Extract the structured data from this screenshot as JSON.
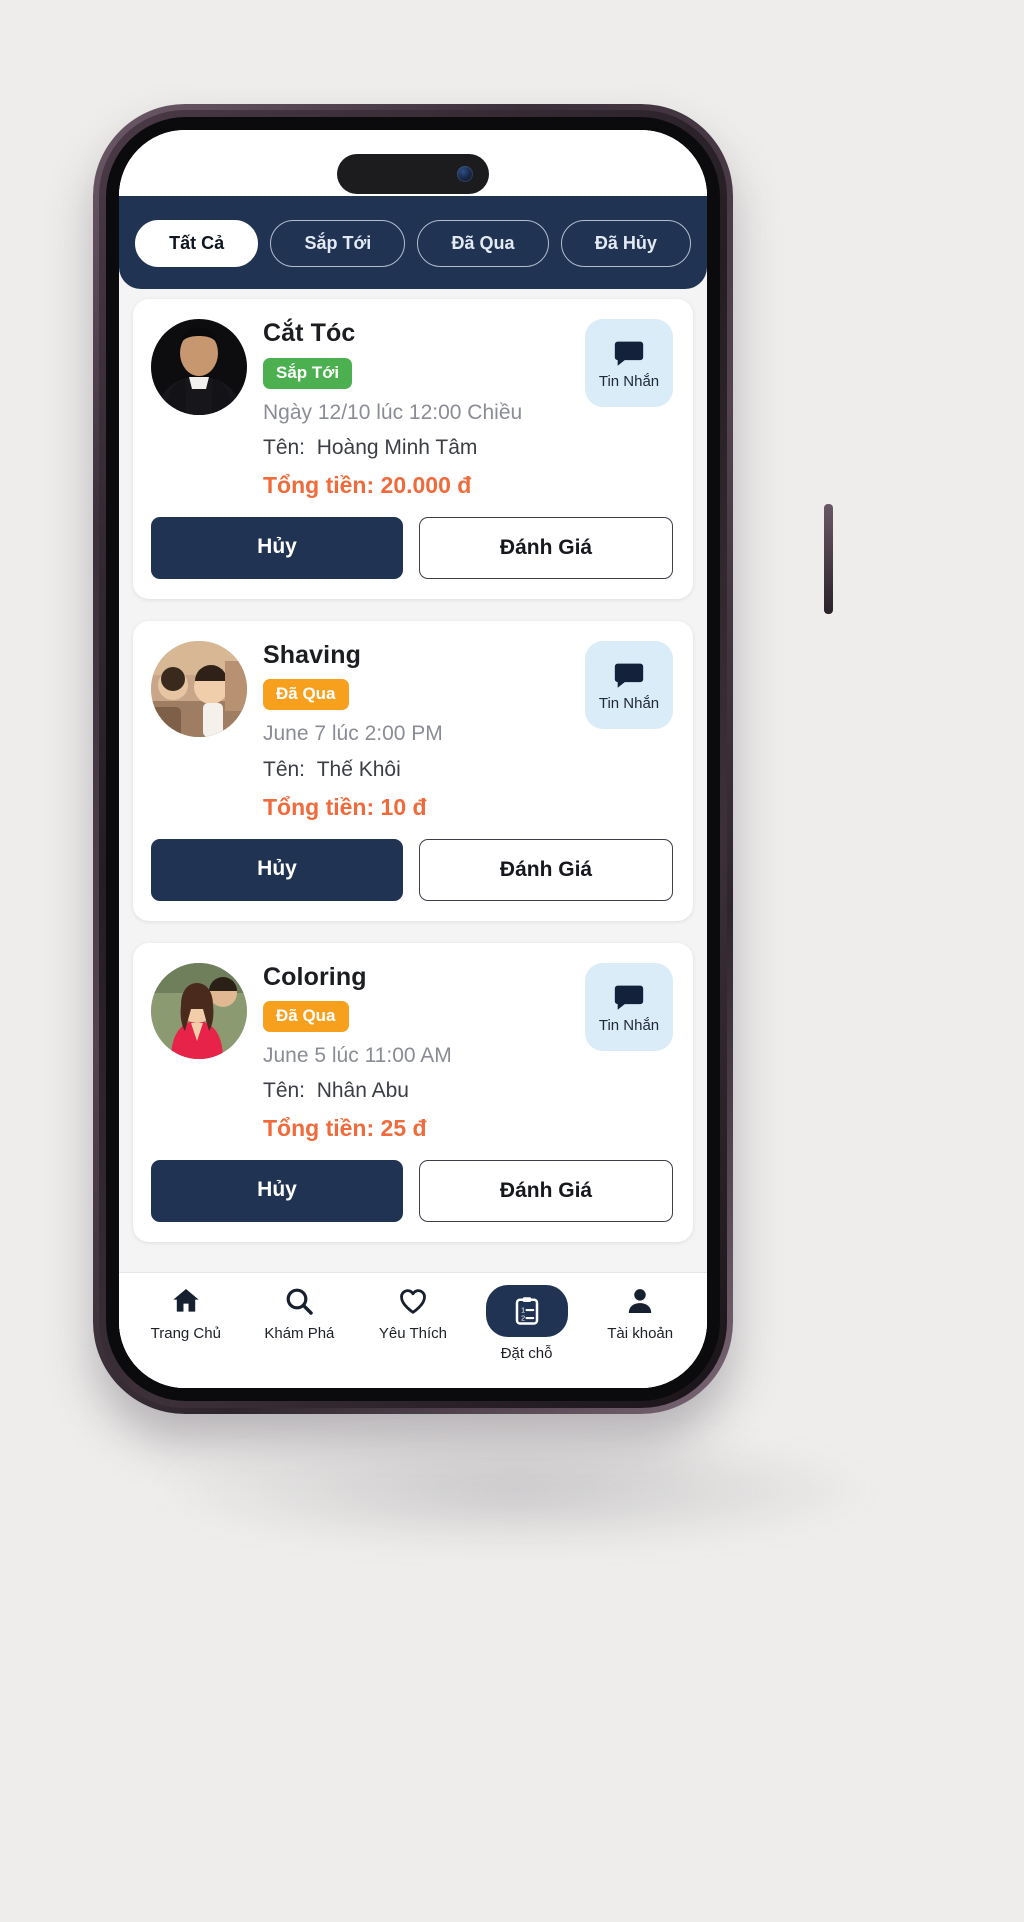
{
  "theme": {
    "navy": "#203352",
    "orange_price": "#ef6b3c",
    "badge_green": "#4caf50",
    "badge_orange": "#f6a01e",
    "msg_bg": "#d9ecf7",
    "screen_bg": "#f4f4f5"
  },
  "tabs": [
    {
      "label": "Tất Cả",
      "active": true
    },
    {
      "label": "Sắp Tới",
      "active": false
    },
    {
      "label": "Đã Qua",
      "active": false
    },
    {
      "label": "Đã Hủy",
      "active": false
    }
  ],
  "message_button": {
    "label": "Tin Nhắn",
    "icon": "chat-bubble-icon"
  },
  "labels": {
    "name_prefix": "Tên:",
    "cancel": "Hủy",
    "review": "Đánh Giá"
  },
  "bookings": [
    {
      "service": "Cắt Tóc",
      "status": "Sắp Tới",
      "status_kind": "upcoming",
      "datetime": "Ngày 12/10 lúc 12:00 Chiều",
      "name_label": "Tên:",
      "customer": "Hoàng Minh Tâm",
      "total": "Tổng tiền: 20.000 đ",
      "cancel": "Hủy",
      "review": "Đánh Giá",
      "message": "Tin Nhắn"
    },
    {
      "service": "Shaving",
      "status": "Đã Qua",
      "status_kind": "past",
      "datetime": "June 7 lúc 2:00 PM",
      "name_label": "Tên:",
      "customer": "Thế Khôi",
      "total": "Tổng tiền: 10 đ",
      "cancel": "Hủy",
      "review": "Đánh Giá",
      "message": "Tin Nhắn"
    },
    {
      "service": "Coloring",
      "status": "Đã Qua",
      "status_kind": "past",
      "datetime": "June 5 lúc 11:00 AM",
      "name_label": "Tên:",
      "customer": "Nhân Abu",
      "total": "Tổng tiền: 25 đ",
      "cancel": "Hủy",
      "review": "Đánh Giá",
      "message": "Tin Nhắn"
    }
  ],
  "bottom_nav": [
    {
      "label": "Trang Chủ",
      "icon": "home-icon",
      "active": false
    },
    {
      "label": "Khám Phá",
      "icon": "search-icon",
      "active": false
    },
    {
      "label": "Yêu Thích",
      "icon": "heart-icon",
      "active": false
    },
    {
      "label": "Đặt chỗ",
      "icon": "clipboard-icon",
      "active": true
    },
    {
      "label": "Tài khoản",
      "icon": "person-icon",
      "active": false
    }
  ]
}
